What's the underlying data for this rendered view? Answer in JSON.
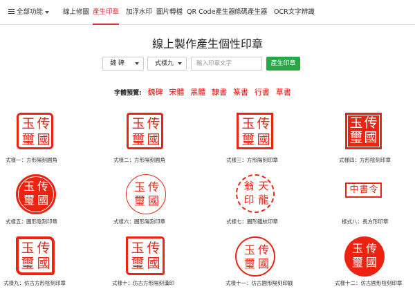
{
  "nav": {
    "all_functions": "全部功能",
    "items": [
      "線上修圖",
      "產生印章",
      "加浮水印",
      "圖片轉檔",
      "QR Code產生器",
      "條碼產生器",
      "OCR文字辨識"
    ]
  },
  "title": "線上製作產生個性印章",
  "form": {
    "font_select": "魏 碑",
    "style_select": "式樣九",
    "text_placeholder": "輸入印章文字",
    "submit": "產生印章"
  },
  "preview": {
    "label": "字體預覽:",
    "fonts": [
      "魏碑",
      "宋體",
      "黑體",
      "隸書",
      "篆書",
      "行書",
      "草書"
    ]
  },
  "seal_text": {
    "c1": "玉",
    "c2": "传",
    "c3": "璽",
    "c4": "國"
  },
  "seal7_text": {
    "a": "天",
    "b": "龍",
    "c": "翁",
    "d": "印"
  },
  "seal8_text": "中書令",
  "captions": [
    "式樣一：方形陽刻圓角",
    "式樣二：方形陽刻圓角",
    "式樣三：方形陽刻印章",
    "式樣四：方形陰刻印章",
    "式樣五：圓形陰刻印章",
    "式樣六：圓形陽刻印章",
    "式樣七：圓形鐵紋印章",
    "樣式八：長方形印章",
    "式樣九：仿古方形陰刻印章",
    "式樣十：仿古方形陽刻漢印",
    "式樣十一：仿古圓形陽刻印戳",
    "式樣十二：仿古圓形陰刻印章"
  ],
  "colors": {
    "accent": "#dd3333",
    "seal_red": "#ee2211",
    "button_green": "#28a745"
  }
}
